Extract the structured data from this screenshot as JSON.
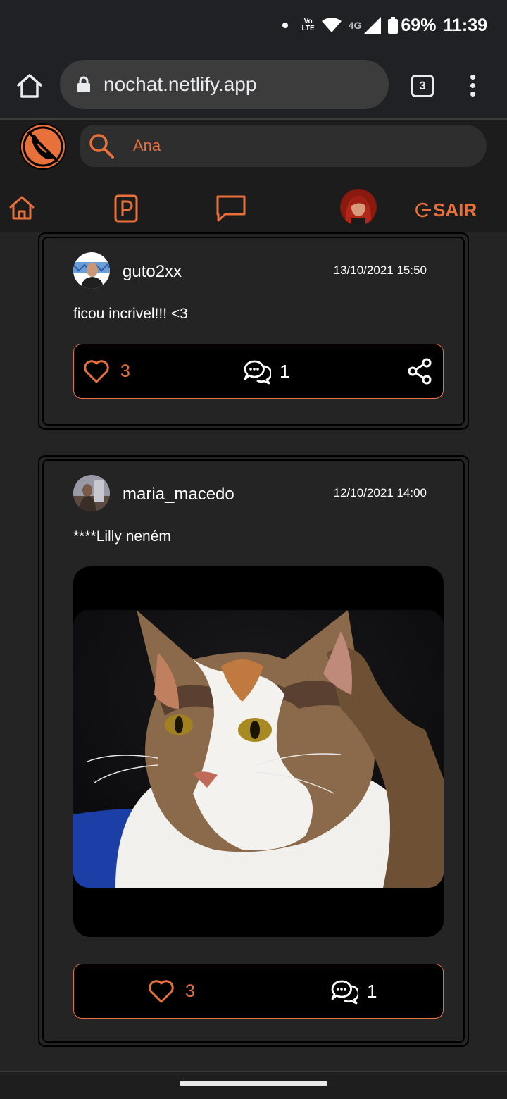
{
  "status_bar": {
    "network_tag_top": "Vo",
    "network_tag_bottom": "LTE",
    "network_type": "4G",
    "battery": "69%",
    "time": "11:39"
  },
  "browser": {
    "url": "nochat.netlify.app",
    "tab_count": "3"
  },
  "app": {
    "search_value": "Ana",
    "logout_label": "SAIR",
    "accent_color": "#e8703a"
  },
  "posts": [
    {
      "username": "guto2xx",
      "timestamp": "13/10/2021 15:50",
      "text": "ficou incrivel!!! <3",
      "likes": "3",
      "comments": "1"
    },
    {
      "username": "maria_macedo",
      "timestamp": "12/10/2021 14:00",
      "text": "****Lilly neném",
      "likes": "3",
      "comments": "1"
    }
  ]
}
